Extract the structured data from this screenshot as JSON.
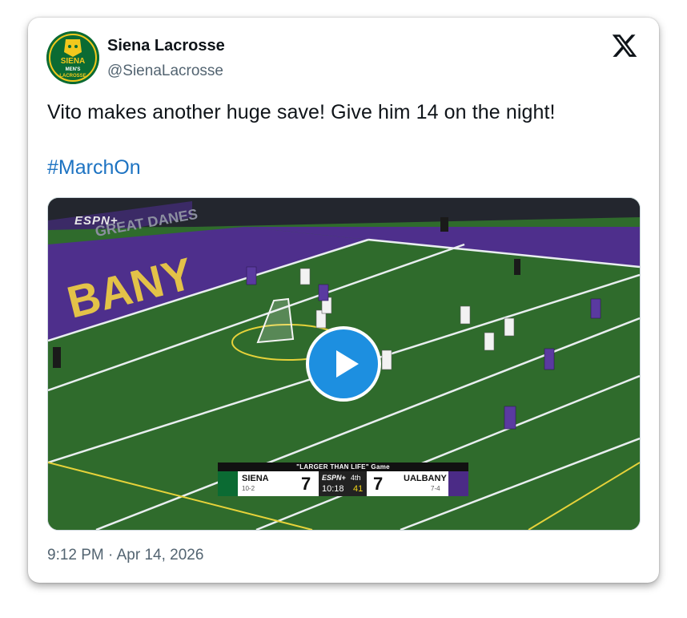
{
  "author": {
    "name": "Siena Lacrosse",
    "handle": "@SienaLacrosse",
    "avatar_text_top": "SIENA",
    "avatar_text_mid": "MEN'S",
    "avatar_text_bottom": "LACROSSE"
  },
  "tweet": {
    "text": "Vito makes another huge save!  Give him 14 on the night!",
    "hashtag": "#MarchOn",
    "timestamp": "9:12 PM · Apr 14, 2026"
  },
  "video": {
    "network_bug": "ESPN+",
    "end_zone_text": "BANY",
    "wall_text": "GREAT DANES",
    "scorebug": {
      "headline": "\"LARGER THAN LIFE\" Game",
      "home_team": "SIENA",
      "home_record": "10-2",
      "home_score": "7",
      "network": "ESPN+",
      "period": "4th",
      "clock": "10:18",
      "shot_clock": "41",
      "away_score": "7",
      "away_team": "UALBANY",
      "away_record": "7-4"
    }
  },
  "icons": {
    "platform": "x-logo-icon",
    "play": "play-icon"
  },
  "colors": {
    "hashtag": "#1d73c2",
    "play_button": "#1d8fe0",
    "siena_green": "#0b6b33",
    "albany_purple": "#4b2b86"
  }
}
